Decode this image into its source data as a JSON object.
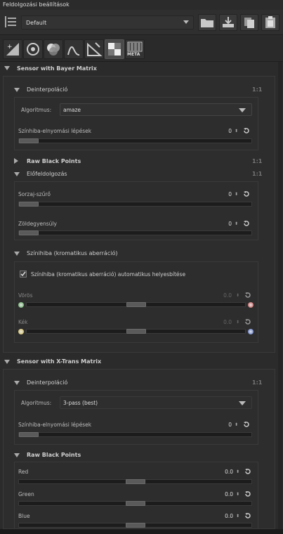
{
  "window": {
    "title": "Feldolgozási beállítások"
  },
  "profile": {
    "value": "Default"
  },
  "tabs": [
    {
      "icon": "exposure-tab-icon"
    },
    {
      "icon": "detail-tab-icon"
    },
    {
      "icon": "color-tab-icon"
    },
    {
      "icon": "wavelet-tab-icon"
    },
    {
      "icon": "transform-tab-icon"
    },
    {
      "icon": "raw-tab-icon"
    },
    {
      "icon": "metadata-tab-icon",
      "label": "META"
    }
  ],
  "bayer": {
    "title": "Sensor with Bayer Matrix",
    "demosaic": {
      "title": "Deinterpoláció",
      "badge": "1:1",
      "algo_label": "Algoritmus:",
      "algo_value": "amaze",
      "fcs_label": "Színhiba-elnyomási lépések",
      "fcs_value": "0"
    },
    "rawblack": {
      "title": "Raw Black Points",
      "badge": "1:1"
    },
    "preprocess": {
      "title": "Előfeldolgozás",
      "badge": "1:1",
      "line_label": "Sorzaj-szűrő",
      "line_value": "0",
      "green_label": "Zöldegyensúly",
      "green_value": "0"
    },
    "ca": {
      "title": "Színihiba (kromatikus aberráció)",
      "auto_label": "Színihiba (kromatikus aberráció) automatikus helyesbítése",
      "red_label": "Vörös",
      "red_value": "0.0",
      "blue_label": "Kék",
      "blue_value": "0.0"
    }
  },
  "xtrans": {
    "title": "Sensor with X-Trans Matrix",
    "demosaic": {
      "title": "Deinterpoláció",
      "badge": "1:1",
      "algo_label": "Algoritmus:",
      "algo_value": "3-pass (best)",
      "fcs_label": "Színhiba-elnyomási lépések",
      "fcs_value": "0"
    },
    "rawblack": {
      "title": "Raw Black Points",
      "red_label": "Red",
      "red_value": "0.0",
      "green_label": "Green",
      "green_value": "0.0",
      "blue_label": "Blue",
      "blue_value": "0.0"
    }
  },
  "sliders": {
    "fcs_bayer": 0,
    "line_noise": 0,
    "green_eq": 0,
    "ca_red": 0.5,
    "ca_blue": 0.5,
    "fcs_xtrans": 0,
    "xt_red": 0.5,
    "xt_green": 0.5,
    "xt_blue": 0.5
  },
  "colors": {
    "accent": "#dcdcdc",
    "background": "#2b2b2b"
  }
}
